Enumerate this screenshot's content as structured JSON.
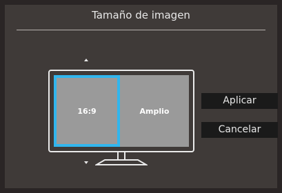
{
  "osd": {
    "title": "Tamaño de imagen"
  },
  "options": {
    "ratio_169": "16:9",
    "wide": "Amplio",
    "selected": "16:9"
  },
  "buttons": {
    "apply": "Aplicar",
    "cancel": "Cancelar"
  },
  "colors": {
    "selection_border": "#31b6ee",
    "panel_background": "#3f3a38"
  }
}
